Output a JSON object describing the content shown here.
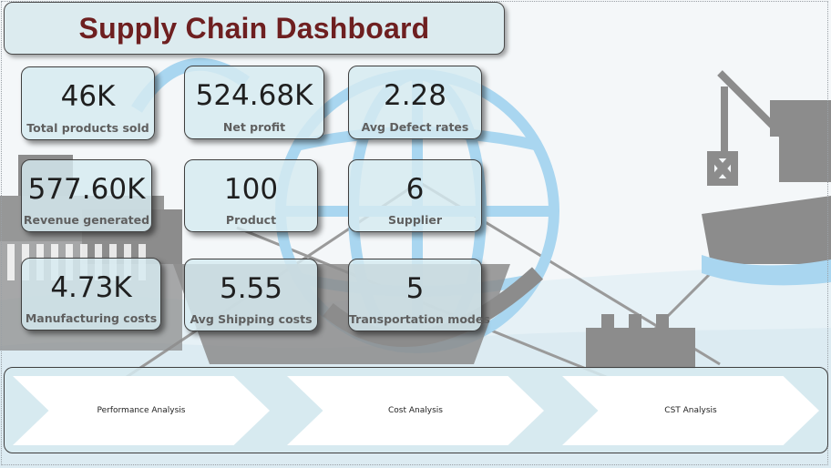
{
  "header": {
    "title": "Supply Chain Dashboard"
  },
  "kpis": [
    {
      "value": "46K",
      "label": "Total products sold"
    },
    {
      "value": "524.68K",
      "label": "Net profit"
    },
    {
      "value": "2.28",
      "label": "Avg Defect rates"
    },
    {
      "value": "577.60K",
      "label": "Revenue generated"
    },
    {
      "value": "100",
      "label": "Product"
    },
    {
      "value": "6",
      "label": "Supplier"
    },
    {
      "value": "4.73K",
      "label": "Manufacturing costs"
    },
    {
      "value": "5.55",
      "label": "Avg Shipping costs"
    },
    {
      "value": "5",
      "label": "Transportation modes"
    }
  ],
  "navigation": [
    {
      "label": "Performance Analysis"
    },
    {
      "label": "Cost Analysis"
    },
    {
      "label": "CST Analysis"
    }
  ],
  "colors": {
    "title": "#6e1f20",
    "card_bg": "#d6eaf0",
    "globe": "#a9d6f0",
    "silhouette": "#8c8c8c"
  },
  "icons": [
    "globe-icon",
    "crane-icon",
    "ship-icon",
    "container-stack-icon",
    "factory-icon",
    "truck-icon"
  ]
}
